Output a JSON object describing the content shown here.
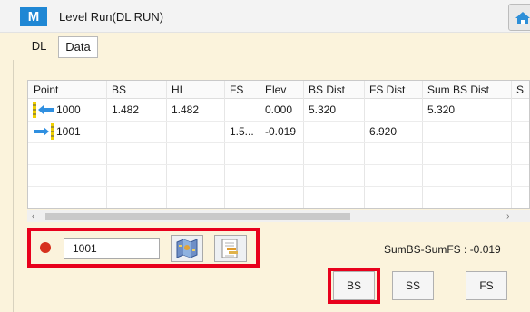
{
  "window": {
    "logo_letter": "M",
    "title": "Level Run(DL RUN)",
    "home_icon": "home-icon"
  },
  "tabs": [
    {
      "label": "DL",
      "active": true
    },
    {
      "label": "Data",
      "active": false
    }
  ],
  "grid": {
    "columns": [
      "Point",
      "BS",
      "HI",
      "FS",
      "Elev",
      "BS Dist",
      "FS Dist",
      "Sum BS Dist",
      "S"
    ],
    "rows": [
      {
        "direction": "backsight",
        "point": "1000",
        "bs": "1.482",
        "hi": "1.482",
        "fs": "",
        "elev": "0.000",
        "bs_dist": "5.320",
        "fs_dist": "",
        "sum_bs_dist": "5.320"
      },
      {
        "direction": "foresight",
        "point": "1001",
        "bs": "",
        "hi": "",
        "fs": "1.5...",
        "elev": "-0.019",
        "bs_dist": "",
        "fs_dist": "6.920",
        "sum_bs_dist": ""
      }
    ],
    "backsight_icon": "left-arrow-staff-icon",
    "foresight_icon": "right-arrow-staff-icon"
  },
  "scrollbar": {
    "left_arrow": "‹",
    "right_arrow": "›"
  },
  "input": {
    "point_value": "1001",
    "status_color": "#d6311e",
    "map_button_icon": "map-icon",
    "list_button_icon": "point-list-icon"
  },
  "summary": {
    "text": "SumBS-SumFS : -0.019"
  },
  "actions": {
    "bs_label": "BS",
    "ss_label": "SS",
    "fs_label": "FS"
  },
  "colors": {
    "highlight": "#e8001c",
    "accent": "#1f87d4",
    "panel_bg": "#fbf3dc"
  }
}
